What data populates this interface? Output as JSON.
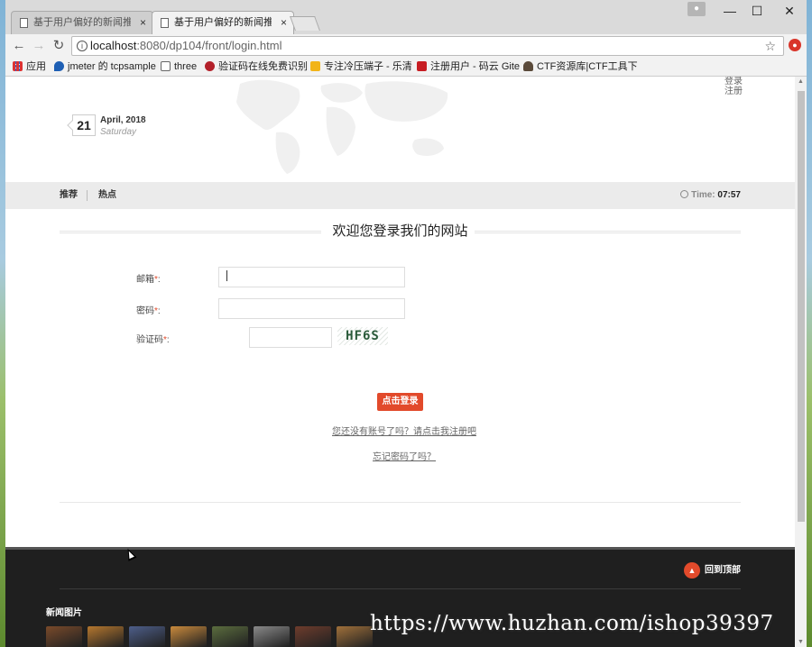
{
  "browser": {
    "tabs": [
      {
        "title": "基于用户偏好的新闻推荐",
        "active": false
      },
      {
        "title": "基于用户偏好的新闻推荐",
        "active": true
      }
    ],
    "tab_close": "×",
    "window_controls": {
      "minimize": "—",
      "maximize": "☐",
      "close": "✕"
    },
    "nav": {
      "back": "←",
      "forward": "→",
      "reload": "↻"
    },
    "url": {
      "host": "localhost",
      "path": ":8080/dp104/front/login.html"
    },
    "info_symbol": "i",
    "star": "☆",
    "bookmarks": [
      {
        "label": "应用",
        "icon": "apps-icon"
      },
      {
        "label": "jmeter 的 tcpsample",
        "icon": "shield-icon"
      },
      {
        "label": "three",
        "icon": "page-icon"
      },
      {
        "label": "验证码在线免费识别",
        "icon": "captcha-icon"
      },
      {
        "label": "专注冷压端子 - 乐清",
        "icon": "folder-icon"
      },
      {
        "label": "注册用户 - 码云 Gite",
        "icon": "gitee-icon"
      },
      {
        "label": "CTF资源库|CTF工具下",
        "icon": "user-icon"
      }
    ]
  },
  "header": {
    "top_links": [
      "登录",
      "注册"
    ],
    "date_day": "21",
    "date_month": "April, 2018",
    "date_weekday": "Saturday"
  },
  "navbar": {
    "items": [
      "推荐",
      "热点"
    ],
    "time_label": "Time:",
    "time_value": "07:57"
  },
  "login": {
    "title": "欢迎您登录我们的网站",
    "email_label": "邮箱",
    "password_label": "密码",
    "captcha_label": "验证码",
    "required_mark": "*",
    "label_colon": ":",
    "captcha_text": "HF6S",
    "submit_label": "点击登录",
    "register_link": "您还没有账号了吗？请点击我注册吧",
    "forgot_link": "忘记密码了吗？"
  },
  "footer": {
    "back_to_top": "回到顶部",
    "news_images_heading": "新闻图片",
    "thumb_colors": [
      "#7a4a2a",
      "#b5772e",
      "#4d5e8a",
      "#c98a3c",
      "#5b6d3e",
      "#8a8a8a",
      "#6e3c2c",
      "#a0703a"
    ]
  },
  "watermark": "https://www.huzhan.com/ishop39397",
  "colors": {
    "accent": "#e24a2b",
    "footer_bg": "#1f1f1f",
    "navbar_bg": "#ebebeb"
  }
}
